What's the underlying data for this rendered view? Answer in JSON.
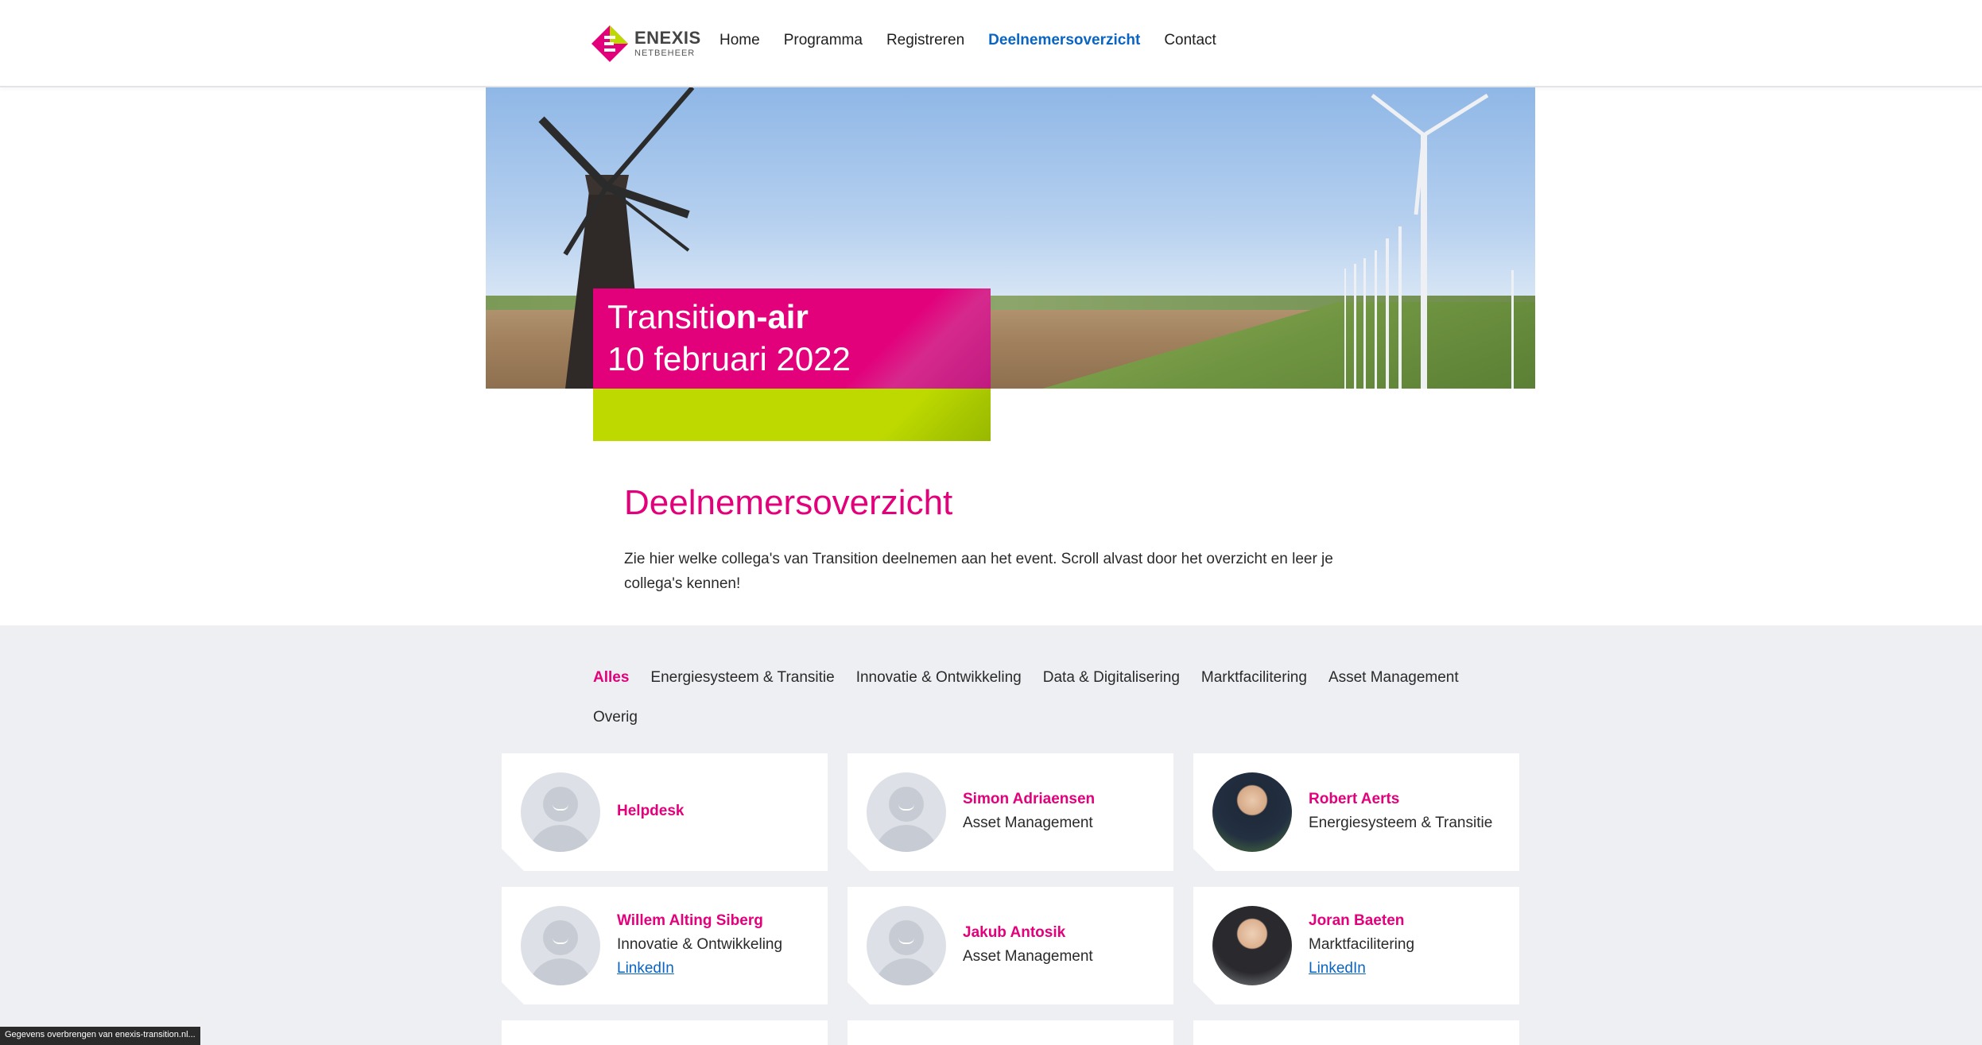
{
  "header": {
    "logo_line1": "ENEXIS",
    "logo_line2": "NETBEHEER",
    "nav": [
      "Home",
      "Programma",
      "Registreren",
      "Deelnemersoverzicht",
      "Contact"
    ],
    "active_nav": "Deelnemersoverzicht"
  },
  "hero": {
    "title_regular": "Transiti",
    "title_bold": "on-air",
    "date": "10 februari 2022"
  },
  "page": {
    "title": "Deelnemersoverzicht",
    "intro": "Zie hier welke collega's van Transition deelnemen aan het event. Scroll alvast door het overzicht en leer je collega's kennen!"
  },
  "filters": [
    "Alles",
    "Energiesysteem & Transitie",
    "Innovatie & Ontwikkeling",
    "Data & Digitalisering",
    "Marktfacilitering",
    "Asset Management",
    "Overig"
  ],
  "active_filter": "Alles",
  "participants": [
    {
      "name": "Helpdesk",
      "dept": "",
      "link": ""
    },
    {
      "name": "Simon Adriaensen",
      "dept": "Asset Management",
      "link": ""
    },
    {
      "name": "Robert Aerts",
      "dept": "Energiesysteem & Transitie",
      "link": ""
    },
    {
      "name": "Willem Alting Siberg",
      "dept": "Innovatie & Ontwikkeling",
      "link": "LinkedIn"
    },
    {
      "name": "Jakub Antosik",
      "dept": "Asset Management",
      "link": ""
    },
    {
      "name": "Joran Baeten",
      "dept": "Marktfacilitering",
      "link": "LinkedIn"
    }
  ],
  "status_bar": "Gegevens overbrengen van enexis-transition.nl...",
  "colors": {
    "brand_magenta": "#e3007b",
    "brand_green": "#bdd900",
    "link_blue": "#0a64c2",
    "section_grey": "#eeeff2"
  }
}
